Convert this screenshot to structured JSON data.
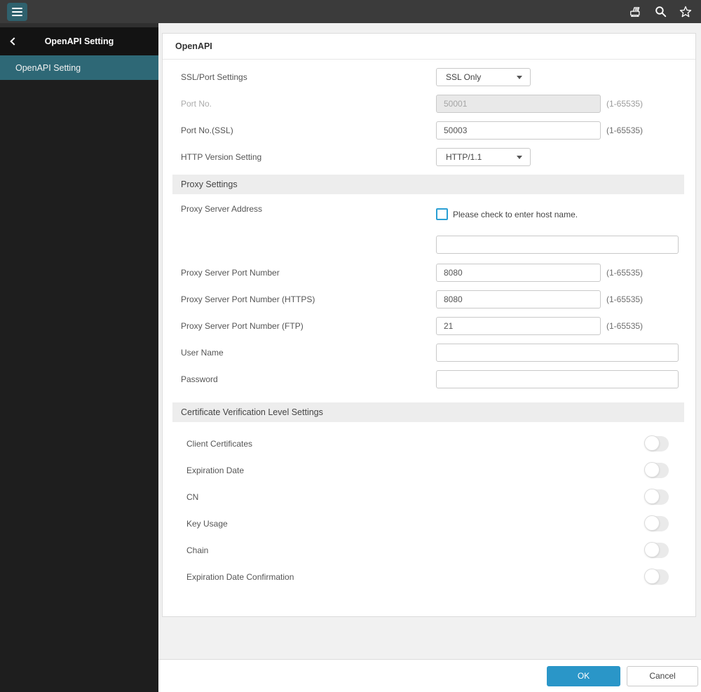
{
  "topbar": {
    "icons": {
      "menu": "hamburger-menu",
      "device": "printer-device",
      "search": "search",
      "favorite": "star-outline"
    }
  },
  "sidebar": {
    "header_title": "OpenAPI Setting",
    "items": [
      {
        "label": "OpenAPI Setting",
        "selected": true
      }
    ]
  },
  "main": {
    "card_title": "OpenAPI",
    "fields": {
      "ssl_port": {
        "label": "SSL/Port Settings",
        "value": "SSL Only"
      },
      "port": {
        "label": "Port No.",
        "value": "50001",
        "hint": "(1-65535)",
        "disabled": true
      },
      "port_ssl": {
        "label": "Port No.(SSL)",
        "value": "50003",
        "hint": "(1-65535)"
      },
      "http_version": {
        "label": "HTTP Version Setting",
        "value": "HTTP/1.1"
      }
    },
    "proxy": {
      "section_title": "Proxy Settings",
      "address": {
        "label": "Proxy Server Address",
        "checkbox_label": "Please check to enter host name.",
        "checked": false,
        "value": ""
      },
      "port": {
        "label": "Proxy Server Port Number",
        "value": "8080",
        "hint": "(1-65535)"
      },
      "port_https": {
        "label": "Proxy Server Port Number (HTTPS)",
        "value": "8080",
        "hint": "(1-65535)"
      },
      "port_ftp": {
        "label": "Proxy Server Port Number (FTP)",
        "value": "21",
        "hint": "(1-65535)"
      },
      "user_name": {
        "label": "User Name",
        "value": ""
      },
      "password": {
        "label": "Password",
        "value": ""
      }
    },
    "certificate": {
      "section_title": "Certificate Verification Level Settings",
      "toggles": [
        {
          "label": "Client Certificates",
          "state": "off"
        },
        {
          "label": "Expiration Date",
          "state": "off"
        },
        {
          "label": "CN",
          "state": "off"
        },
        {
          "label": "Key Usage",
          "state": "off"
        },
        {
          "label": "Chain",
          "state": "off"
        },
        {
          "label": "Expiration Date Confirmation",
          "state": "off"
        }
      ]
    },
    "footer": {
      "ok_label": "OK",
      "cancel_label": "Cancel"
    }
  },
  "colors": {
    "topbar_bg": "#3b3b3b",
    "accent_teal": "#2e6876",
    "accent_blue": "#2a96c8",
    "checkbox_blue": "#2a9fd4",
    "sidebar_bg": "#1e1e1e",
    "section_bar_bg": "#ededed",
    "disabled_input_bg": "#e9e9e9"
  }
}
